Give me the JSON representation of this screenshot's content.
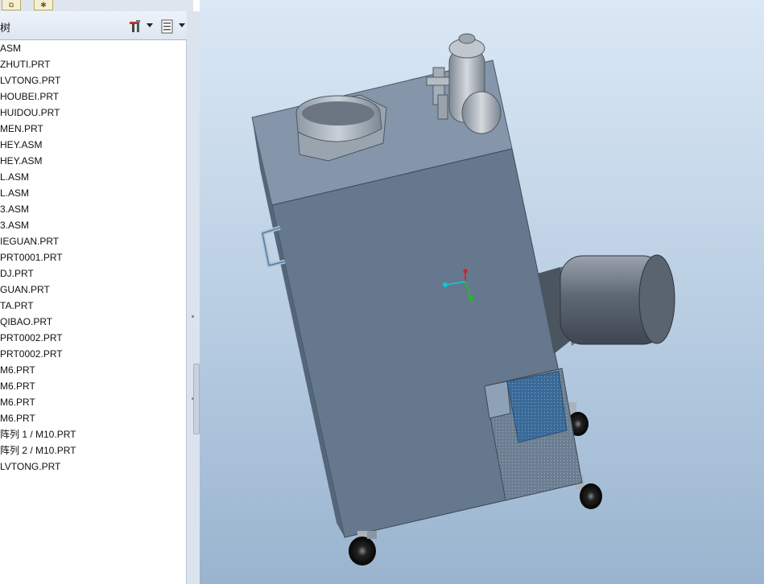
{
  "tabs": [
    {
      "name": "model-tree-tab",
      "glyph": "⧉"
    },
    {
      "name": "favorites-tab",
      "glyph": "✱"
    }
  ],
  "panel": {
    "title": "树"
  },
  "tree": {
    "items": [
      "ASM",
      "ZHUTI.PRT",
      "LVTONG.PRT",
      "HOUBEI.PRT",
      "HUIDOU.PRT",
      "MEN.PRT",
      "HEY.ASM",
      "HEY.ASM",
      "L.ASM",
      "L.ASM",
      "3.ASM",
      "3.ASM",
      "IEGUAN.PRT",
      "PRT0001.PRT",
      "DJ.PRT",
      "GUAN.PRT",
      "TA.PRT",
      "QIBAO.PRT",
      "PRT0002.PRT",
      "PRT0002.PRT",
      "M6.PRT",
      "M6.PRT",
      "M6.PRT",
      "M6.PRT",
      "阵列 1 / M10.PRT",
      "阵列 2 / M10.PRT",
      "LVTONG.PRT"
    ]
  },
  "colors": {
    "box_front": "#65788d",
    "box_top": "#8596aa",
    "motor": "#6f7a86",
    "vent": "#3d6f9e",
    "axis_x": "#d42020",
    "axis_y": "#18c318",
    "axis_z": "#10c8d8"
  }
}
